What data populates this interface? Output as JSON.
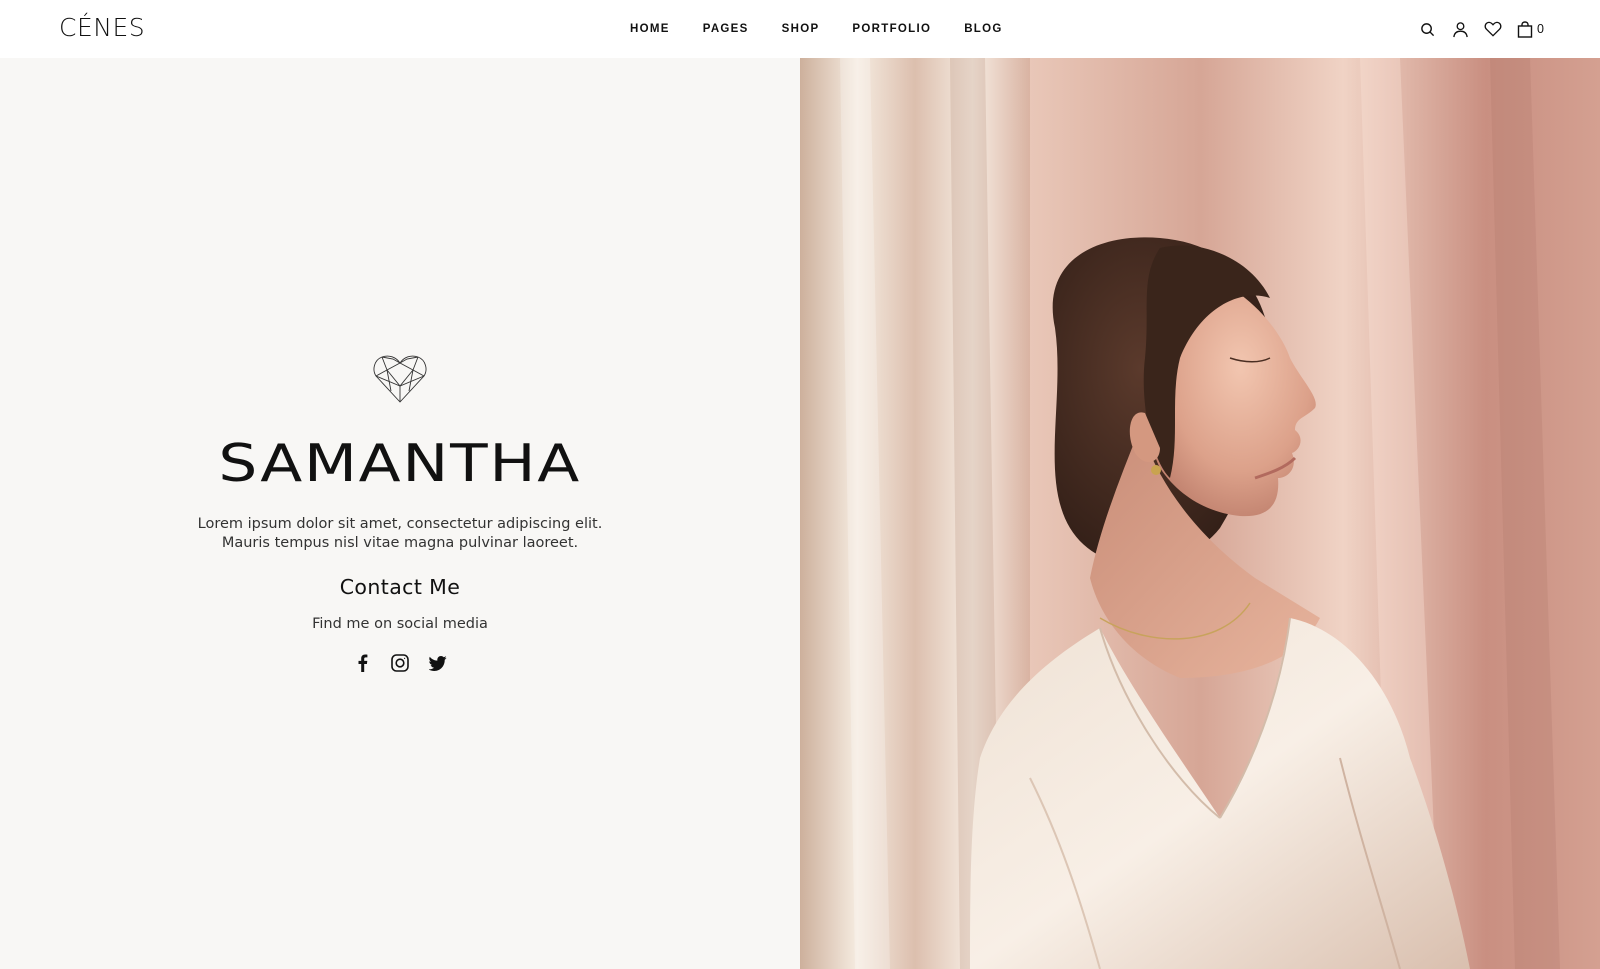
{
  "header": {
    "logo": "CÉNES",
    "nav": [
      {
        "label": "HOME"
      },
      {
        "label": "PAGES"
      },
      {
        "label": "SHOP"
      },
      {
        "label": "PORTFOLIO"
      },
      {
        "label": "BLOG"
      }
    ],
    "icons": [
      "search-icon",
      "user-icon",
      "heart-icon",
      "bag-icon"
    ],
    "cart_count": "0"
  },
  "intro": {
    "emblem_icon": "diamond-heart-icon",
    "name": "SAMANTHA",
    "bio_line1": "Lorem ipsum dolor sit amet, consectetur adipiscing elit.",
    "bio_line2": "Mauris tempus nisl vitae magna pulvinar laoreet.",
    "contact_heading": "Contact Me",
    "social_caption": "Find me on social media",
    "social_icons": [
      "facebook-icon",
      "instagram-icon",
      "twitter-icon"
    ]
  },
  "photo": {
    "subject": "woman-portrait-photo",
    "palette": [
      "#f3e4d7",
      "#d8b4a1",
      "#c48c7d",
      "#4a2e22",
      "#f1e6da"
    ]
  }
}
